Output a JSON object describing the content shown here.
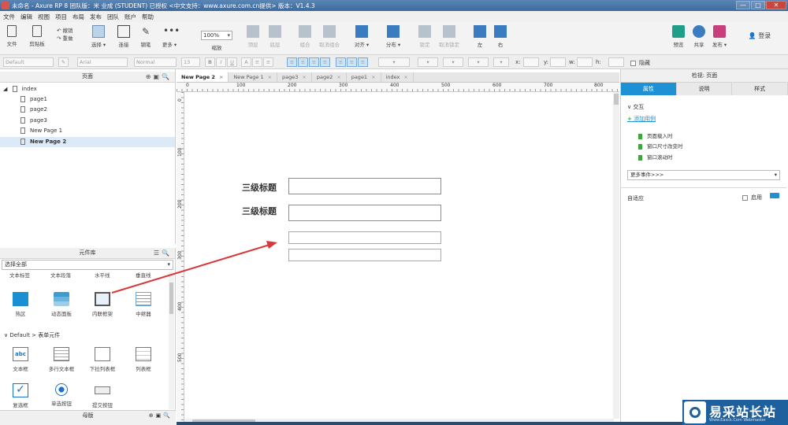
{
  "window": {
    "title": "未命名 - Axure RP 8 团队版：米 业成 (STUDENT) 已授权    <中文支持：www.axure.com.cn提供> 版本：V1.4.3",
    "minimize": "—",
    "maximize": "□",
    "close": "✕"
  },
  "menu": [
    "文件",
    "编辑",
    "视图",
    "项目",
    "布局",
    "发布",
    "团队",
    "账户",
    "帮助"
  ],
  "toolbar": {
    "file": "文件",
    "clipboard": "剪贴板",
    "undo": "撤销",
    "redo": "重做",
    "select": "选择",
    "connect": "连接",
    "pen": "钢笔",
    "more": "更多",
    "zoom_value": "100%",
    "zoom": "缩放",
    "top": "顶层",
    "bottom": "底层",
    "group": "组合",
    "ungroup": "取消组合",
    "align": "对齐",
    "distribute": "分布",
    "lock": "锁定",
    "unlock": "取消锁定",
    "left": "左",
    "right": "右",
    "preview": "预览",
    "share": "共享",
    "publish": "发布",
    "login": "登录"
  },
  "formatbar": {
    "style": "Default",
    "font": "Arial",
    "weight": "Normal",
    "size": "13",
    "bold": "B",
    "italic": "I",
    "underline": "U",
    "x_label": "x:",
    "y_label": "y:",
    "w_label": "w:",
    "h_label": "h:",
    "hide": "隐藏"
  },
  "pages_panel": {
    "title": "页面",
    "root": "index",
    "pages": [
      "page1",
      "page2",
      "page3",
      "New Page 1",
      "New Page 2"
    ],
    "active": "New Page 2"
  },
  "library_panel": {
    "title": "元件库",
    "filter": "选择全部",
    "cut_row": [
      "文本标签",
      "文本段落",
      "水平线",
      "垂直线"
    ],
    "row1": [
      "热区",
      "动态面板",
      "内联框架",
      "中继器"
    ],
    "group_title": "Default > 表单元件",
    "row2": [
      "文本框",
      "多行文本框",
      "下拉列表框",
      "列表框"
    ],
    "row3": [
      "复选框",
      "单选按钮",
      "提交按钮"
    ],
    "text_icon": "abc"
  },
  "master_panel": {
    "title": "母版"
  },
  "tabs": [
    "New Page 2",
    "New Page 1",
    "page3",
    "page2",
    "page1",
    "index"
  ],
  "rulers": {
    "h": [
      "0",
      "100",
      "200",
      "300",
      "400",
      "500",
      "600",
      "700",
      "800"
    ],
    "v": [
      "0",
      "100",
      "200",
      "300",
      "400",
      "500"
    ]
  },
  "canvas": {
    "heading1": "三级标题",
    "heading2": "三级标题"
  },
  "inspector": {
    "title": "检视: 页面",
    "tabs": [
      "属性",
      "说明",
      "样式"
    ],
    "interaction": "交互",
    "add_case": "添加用例",
    "events": [
      "页面载入时",
      "窗口尺寸改变时",
      "窗口滚动时"
    ],
    "more_events": "更多事件>>>",
    "adaptive": "自适应",
    "enable": "启用"
  },
  "watermark": {
    "text": "易采站长站",
    "sub": "Www.Easck.Com Webmaster"
  },
  "colors": {
    "accent": "#1e90d4",
    "arrow": "#d9383a",
    "title_bar": "#3d6a9c"
  }
}
